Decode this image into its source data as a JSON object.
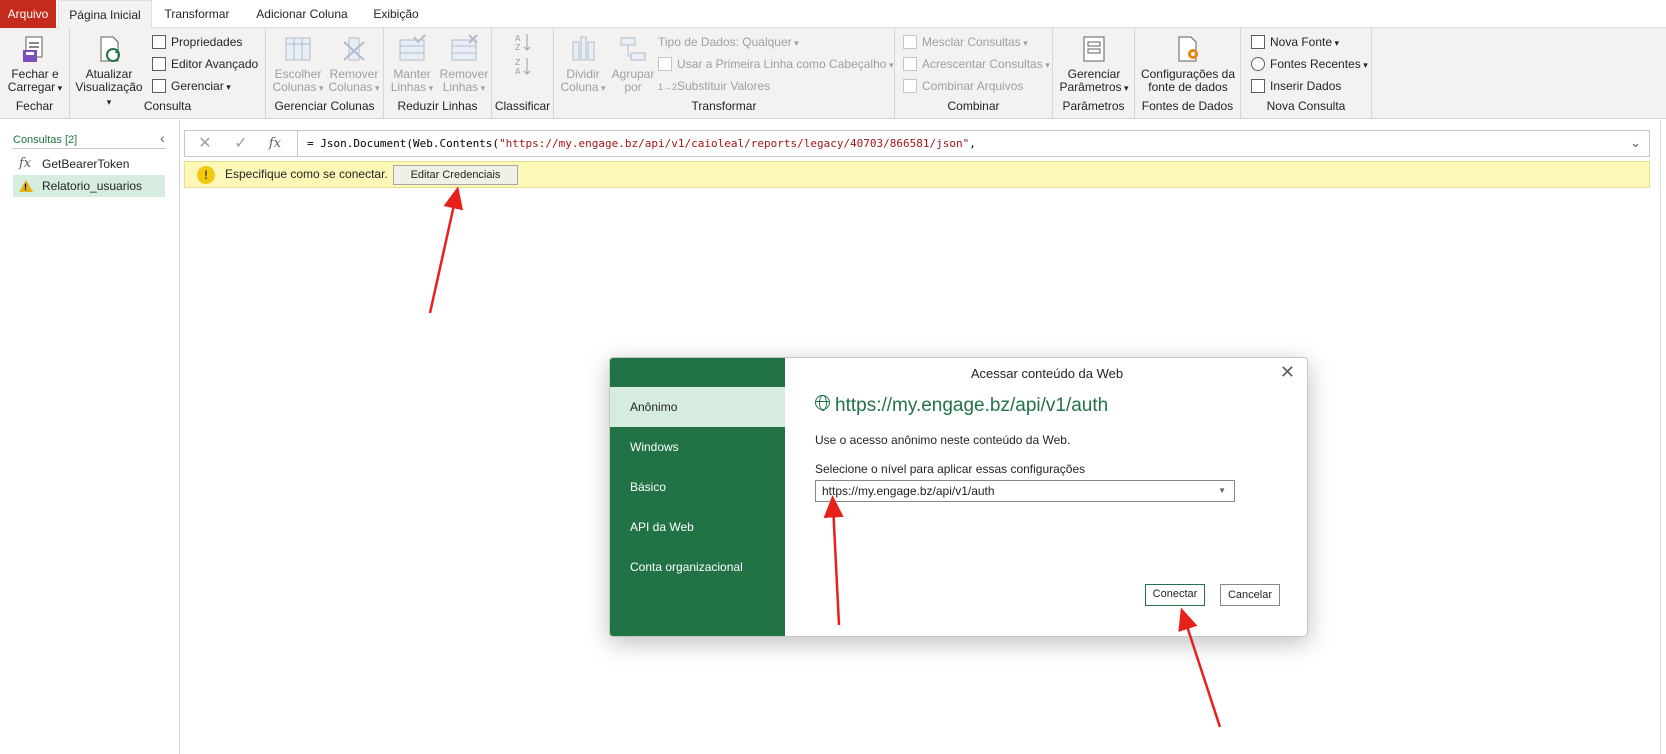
{
  "tabs": [
    {
      "label": "Arquivo"
    },
    {
      "label": "Página Inicial"
    },
    {
      "label": "Transformar"
    },
    {
      "label": "Adicionar Coluna"
    },
    {
      "label": "Exibição"
    }
  ],
  "ribbon": {
    "groups": {
      "fechar": "Fechar",
      "consulta": "Consulta",
      "gerenciar_colunas": "Gerenciar Colunas",
      "reduzir_linhas": "Reduzir Linhas",
      "classificar": "Classificar",
      "transformar": "Transformar",
      "combinar": "Combinar",
      "parametros": "Parâmetros",
      "fontes_de_dados": "Fontes de Dados",
      "nova_consulta": "Nova Consulta"
    },
    "fechar_carregar": [
      "Fechar e",
      "Carregar"
    ],
    "atualizar_visualizacao": [
      "Atualizar",
      "Visualização"
    ],
    "propriedades": "Propriedades",
    "editor_avancado": "Editor Avançado",
    "gerenciar": "Gerenciar",
    "escolher_colunas": [
      "Escolher",
      "Colunas"
    ],
    "remover_colunas": [
      "Remover",
      "Colunas"
    ],
    "manter_linhas": [
      "Manter",
      "Linhas"
    ],
    "remover_linhas": [
      "Remover",
      "Linhas"
    ],
    "dividir_coluna": [
      "Dividir",
      "Coluna"
    ],
    "agrupar_por": [
      "Agrupar",
      "por"
    ],
    "tipo_dados": "Tipo de Dados: Qualquer",
    "primeira_linha": "Usar a Primeira Linha como Cabeçalho",
    "substituir_valores": "Substituir Valores",
    "mesclar_consultas": "Mesclar Consultas",
    "acrescentar_consultas": "Acrescentar Consultas",
    "combinar_arquivos": "Combinar Arquivos",
    "gerenciar_parametros": [
      "Gerenciar",
      "Parâmetros"
    ],
    "config_fonte": [
      "Configurações da",
      "fonte de dados"
    ],
    "nova_fonte": "Nova Fonte",
    "fontes_recentes": "Fontes Recentes",
    "inserir_dados": "Inserir Dados"
  },
  "queries_pane": {
    "title": "Consultas [2]",
    "items": [
      {
        "label": "GetBearerToken"
      },
      {
        "label": "Relatorio_usuarios"
      }
    ]
  },
  "formula_bar": {
    "prefix": "= Json.Document(Web.Contents(",
    "string": "\"https://my.engage.bz/api/v1/caioleal/reports/legacy/40703/866581/json\"",
    "suffix": ","
  },
  "banner": {
    "text": "Especifique como se conectar.",
    "button": "Editar Credenciais"
  },
  "dialog": {
    "title": "Acessar conteúdo da Web",
    "sidebar": [
      {
        "label": "Anônimo"
      },
      {
        "label": "Windows"
      },
      {
        "label": "Básico"
      },
      {
        "label": "API da Web"
      },
      {
        "label": "Conta organizacional"
      }
    ],
    "url": "https://my.engage.bz/api/v1/auth",
    "description": "Use o acesso anônimo neste conteúdo da Web.",
    "level_label": "Selecione o nível para aplicar essas configurações",
    "level_value": "https://my.engage.bz/api/v1/auth",
    "connect": "Conectar",
    "cancel": "Cancelar"
  },
  "colors": {
    "accent_green": "#217346",
    "file_red": "#c42b1c",
    "banner_yellow": "#fdf8b7",
    "arrow_red": "#e8201a"
  }
}
